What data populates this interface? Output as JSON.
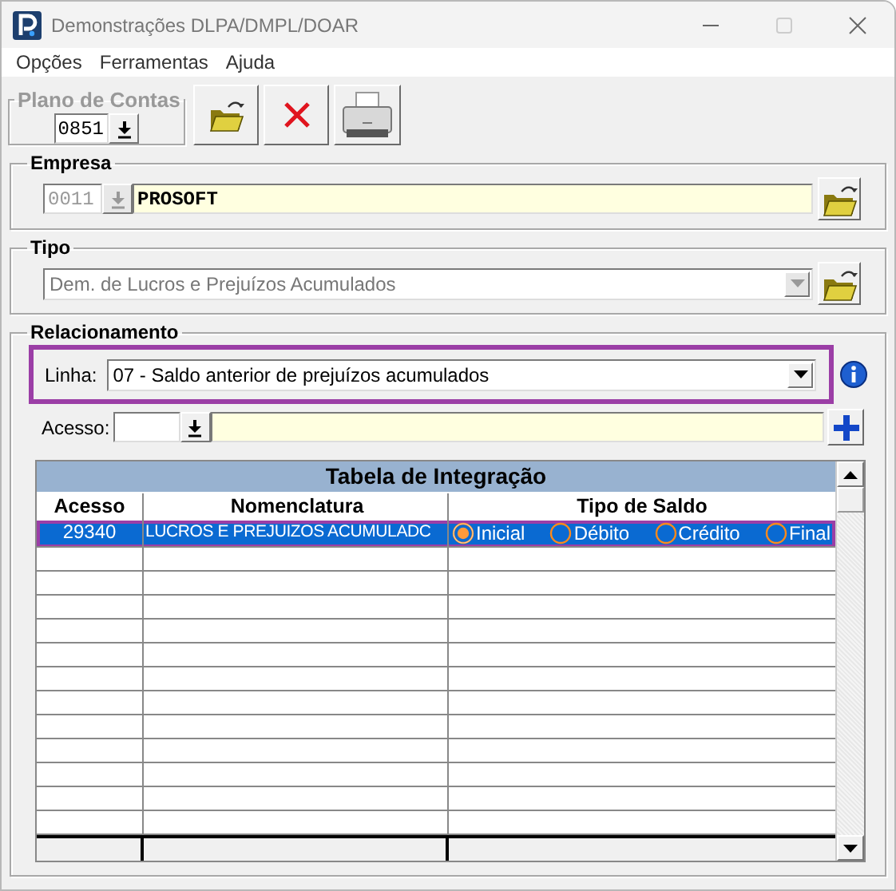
{
  "window": {
    "title": "Demonstrações DLPA/DMPL/DOAR"
  },
  "menu": [
    "Opções",
    "Ferramentas",
    "Ajuda"
  ],
  "plano_de_contas": {
    "label": "Plano de Contas",
    "value": "0851"
  },
  "empresa": {
    "label": "Empresa",
    "code": "0011",
    "name": "PROSOFT",
    "disabled": true
  },
  "tipo": {
    "label": "Tipo",
    "value": "Dem. de Lucros e Prejuízos Acumulados",
    "disabled": true
  },
  "relacionamento": {
    "label": "Relacionamento",
    "linha": {
      "label": "Linha:",
      "value": "07 - Saldo anterior de prejuízos acumulados",
      "highlighted": true
    },
    "acesso": {
      "label": "Acesso:"
    }
  },
  "table": {
    "title": "Tabela de Integração",
    "columns": [
      "Acesso",
      "Nomenclatura",
      "Tipo de Saldo"
    ],
    "rows": [
      {
        "acesso": "29340",
        "nomenclatura": "LUCROS E PREJUIZOS ACUMULADC",
        "selected": true,
        "highlighted": true,
        "options": [
          {
            "label": "Inicial",
            "selected": true
          },
          {
            "label": "Débito",
            "selected": false
          },
          {
            "label": "Crédito",
            "selected": false
          },
          {
            "label": "Final",
            "selected": false
          }
        ]
      }
    ]
  }
}
